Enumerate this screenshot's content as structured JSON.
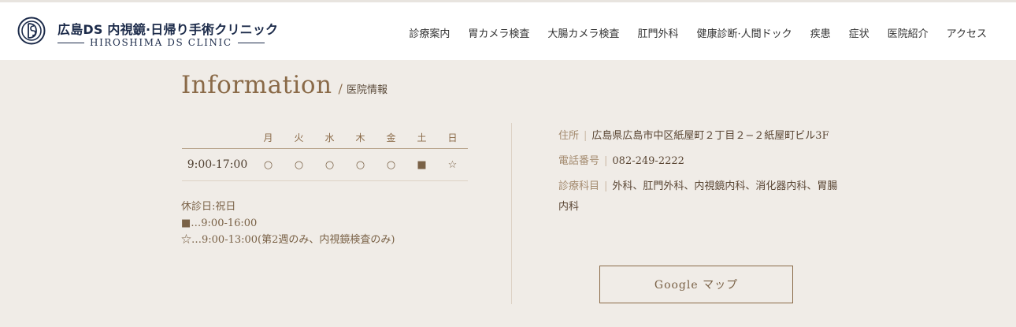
{
  "header": {
    "logo_title": "広島DS 内視鏡·日帰り手術クリニック",
    "logo_sub": "HIROSHIMA DS CLINIC",
    "nav": [
      "診療案内",
      "胃カメラ検査",
      "大腸カメラ検査",
      "肛門外科",
      "健康診断·人間ドック",
      "疾患",
      "症状",
      "医院紹介",
      "アクセス"
    ]
  },
  "info": {
    "title_en": "Information",
    "title_sep": "/",
    "title_jp": "医院情報"
  },
  "hours": {
    "days": [
      "月",
      "火",
      "水",
      "木",
      "金",
      "土",
      "日"
    ],
    "time": "9:00-17:00",
    "marks": [
      "○",
      "○",
      "○",
      "○",
      "○",
      "■",
      "☆"
    ]
  },
  "notes": {
    "closed": "休診日:祝日",
    "square": "■…9:00-16:00",
    "star": "☆…9:00-13:00(第2週のみ、内視鏡検査のみ)"
  },
  "details": {
    "address_label": "住所",
    "address": "広島県広島市中区紙屋町２丁目２−２紙屋町ビル3F",
    "phone_label": "電話番号",
    "phone": "082-249-2222",
    "dept_label": "診療科目",
    "dept": "外科、肛門外科、内視鏡内科、消化器内科、胃腸内科"
  },
  "gmap_label": "Google マップ",
  "colors": {
    "background": "#f0ece7",
    "accent": "#8a6a48",
    "brand_navy": "#1c2b4a"
  }
}
